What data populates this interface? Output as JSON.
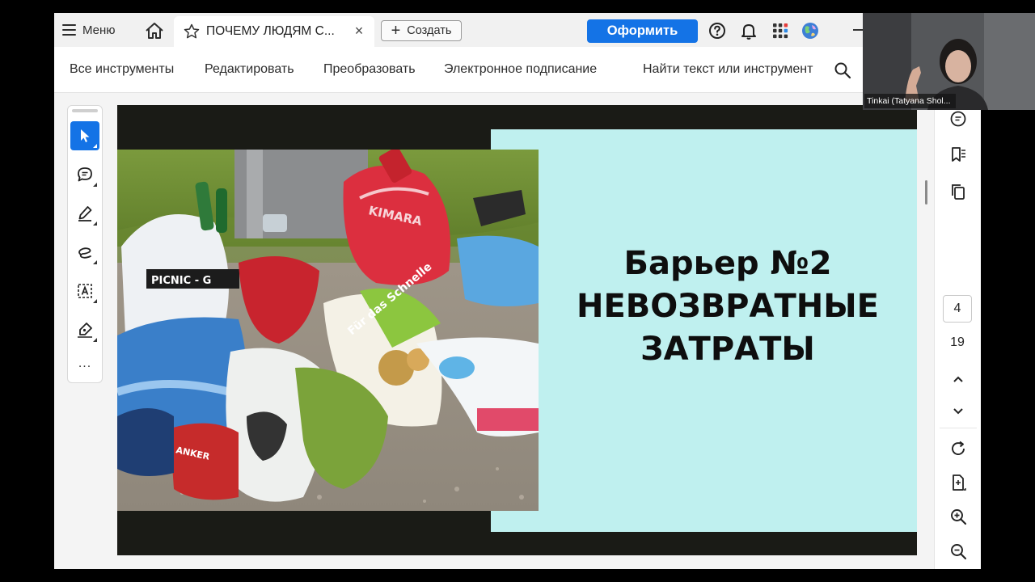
{
  "titlebar": {
    "menu_label": "Меню",
    "tab_title": "ПОЧЕМУ ЛЮДЯМ С...",
    "tab_close": "×",
    "create_label": "Создать",
    "create_icon": "+",
    "buy_label": "Оформить"
  },
  "tools": {
    "all_tools": "Все инструменты",
    "edit": "Редактировать",
    "convert": "Преобразовать",
    "esign": "Электронное подписание",
    "search": "Найти текст или инструмент"
  },
  "left_toolbar": {
    "more": "..."
  },
  "slide": {
    "line1": "Барьер №2",
    "line2": "НЕВОЗВРАТНЫЕ",
    "line3": "ЗАТРАТЫ",
    "bag_text_1": "PICNIC - G",
    "bag_text_2": "Für das Schnelle",
    "bag_text_3": "KIMARA",
    "bag_text_4": "ANKER"
  },
  "navigation": {
    "current_page": "4",
    "total_pages": "19"
  },
  "webcam": {
    "participant_name": "Tinkai (Tatyana Shol..."
  },
  "colors": {
    "accent": "#1473e6",
    "slide_bg": "#1a1b16",
    "slide_panel": "#bff0ef"
  }
}
